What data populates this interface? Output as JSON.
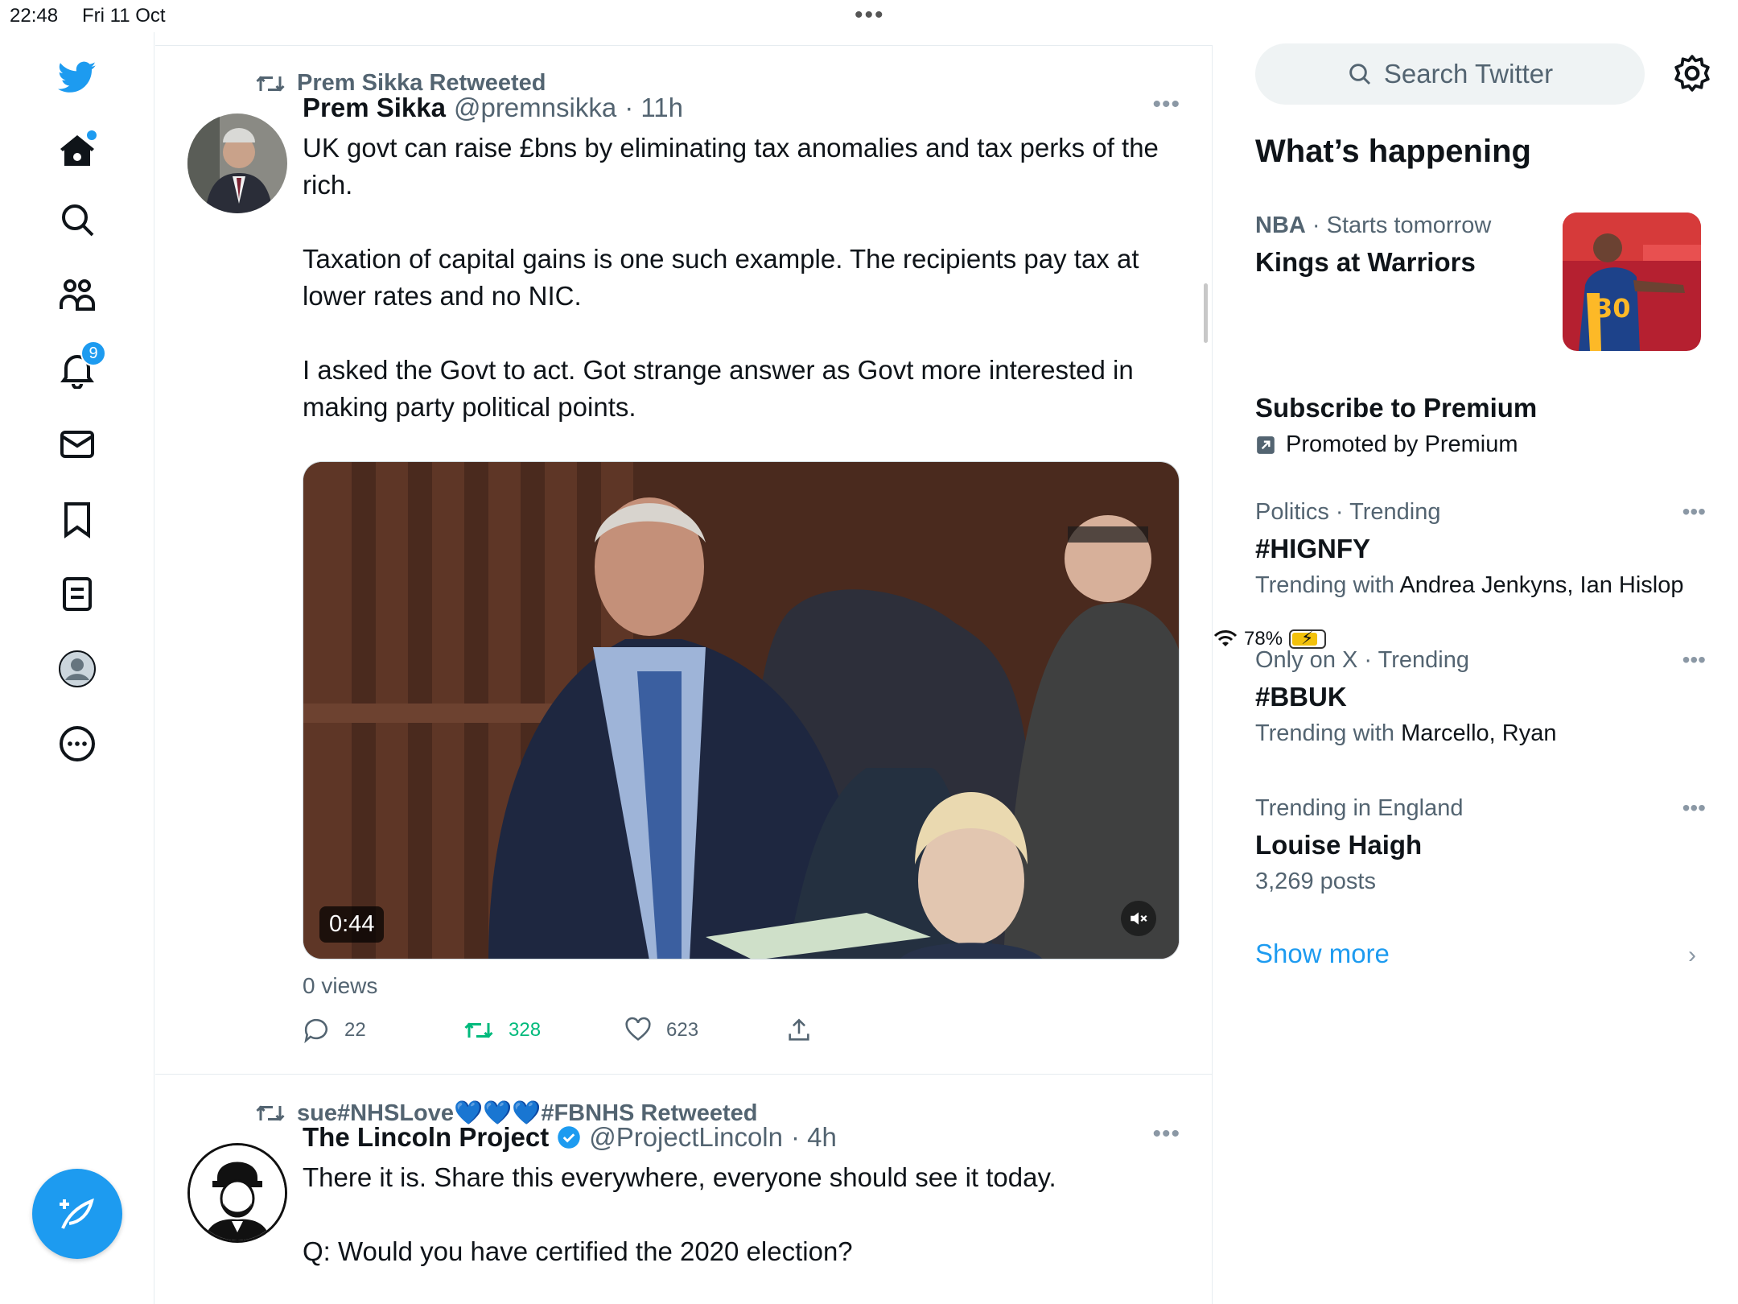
{
  "status_bar": {
    "time": "22:48",
    "date": "Fri 11 Oct",
    "battery": "78%",
    "dots": "•••"
  },
  "nav": {
    "items": [
      "twitter-logo",
      "home",
      "explore",
      "communities",
      "notifications",
      "messages",
      "bookmarks",
      "lists",
      "profile",
      "more"
    ],
    "notifications_badge": "9"
  },
  "tweets": [
    {
      "retweeted_by": "Prem Sikka Retweeted",
      "name": "Prem Sikka",
      "handle": "@premnsikka",
      "time": "· 11h",
      "paragraphs": [
        "UK govt can raise £bns by eliminating tax anomalies and tax perks of the rich.",
        "Taxation of capital gains is one such example. The recipients pay tax at lower rates and no NIC.",
        "I asked the Govt to act. Got strange answer as Govt more interested in making party political points."
      ],
      "video_duration": "0:44",
      "views": "0 views",
      "replies": "22",
      "retweets": "328",
      "likes": "623"
    },
    {
      "retweeted_by": "sue#NHSLove💙💙💙#FBNHS Retweeted",
      "name": "The Lincoln Project",
      "handle": "@ProjectLincoln",
      "time": "· 4h",
      "paragraphs": [
        "There it is. Share this everywhere, everyone should see it today.",
        "Q: Would you have certified the 2020 election?"
      ]
    }
  ],
  "sidebar": {
    "search_placeholder": "Search Twitter",
    "section_title": "What’s happening",
    "nba": {
      "league": "NBA",
      "when": " · Starts tomorrow",
      "title": "Kings at Warriors"
    },
    "promo": {
      "title": "Subscribe to Premium",
      "meta": "Promoted by Premium"
    },
    "trends": [
      {
        "meta": "Politics · Trending",
        "title": "#HIGNFY",
        "sub_prefix": "Trending with ",
        "sub_names": "Andrea Jenkyns, Ian Hislop"
      },
      {
        "meta": "Only on X · Trending",
        "title": "#BBUK",
        "sub_prefix": "Trending with ",
        "sub_names": "Marcello, Ryan"
      },
      {
        "meta": "Trending in England",
        "title": "Louise Haigh",
        "sub_prefix": "3,269 posts",
        "sub_names": ""
      }
    ],
    "show_more": "Show more"
  },
  "colors": {
    "accent": "#1d9bf0",
    "retweet_green": "#00ba7c",
    "secondary_text": "#536471"
  }
}
